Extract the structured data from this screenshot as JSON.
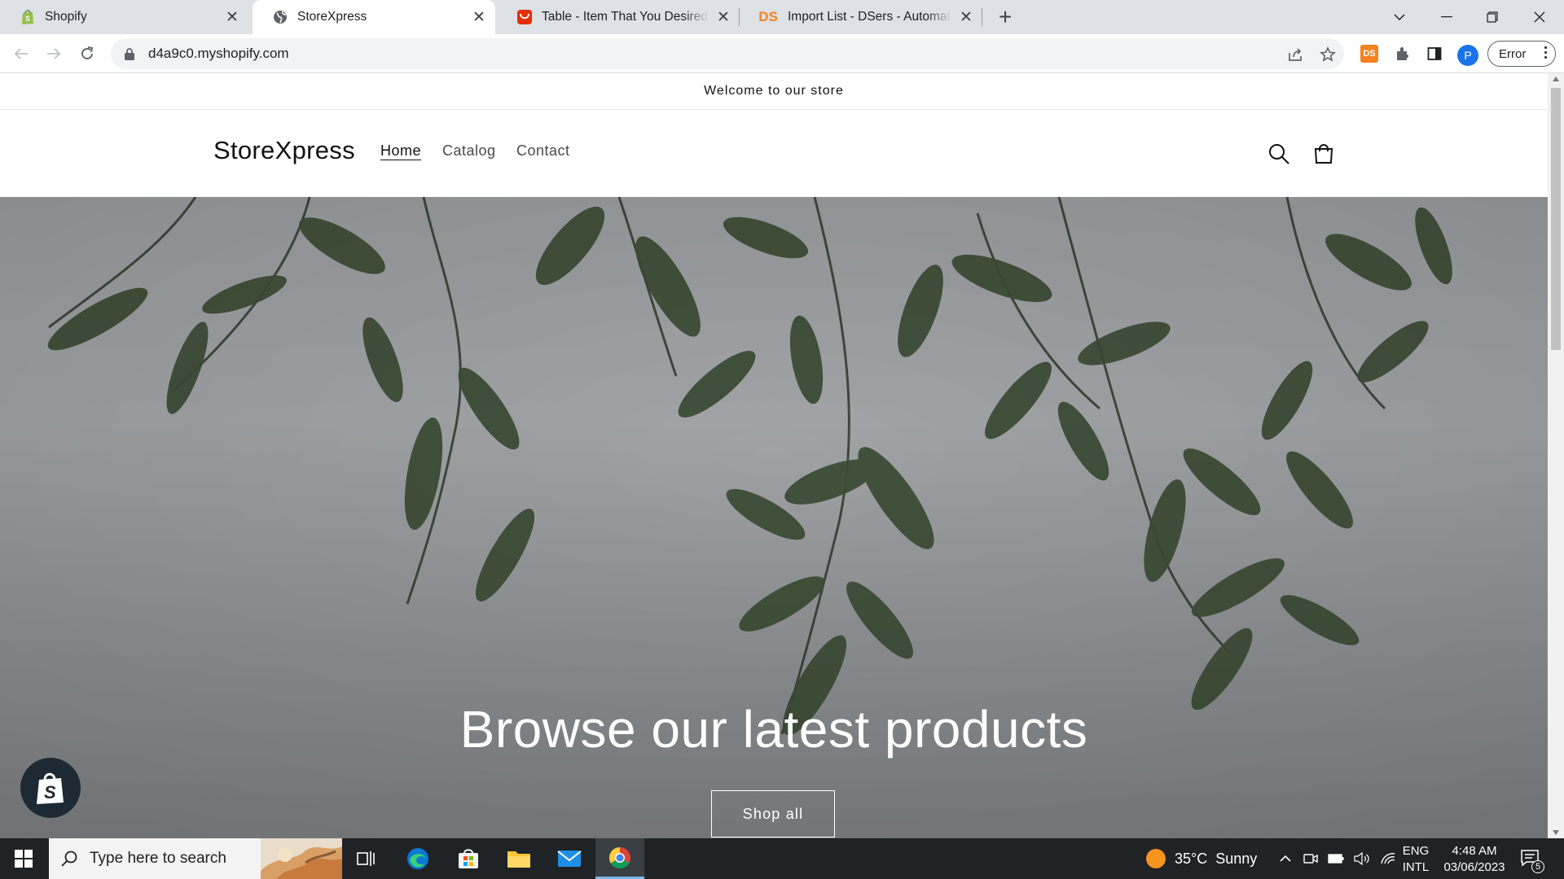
{
  "browser": {
    "tabs": [
      {
        "title": "Shopify",
        "icon": "shopify-icon",
        "active": false
      },
      {
        "title": "StoreXpress",
        "icon": "globe-icon",
        "active": true
      },
      {
        "title": "Table - Item That You Desired - A",
        "icon": "aliexpress-icon",
        "active": false
      },
      {
        "title": "Import List - DSers - Automation",
        "icon": "dsers-icon",
        "active": false
      }
    ],
    "url": "d4a9c0.myshopify.com",
    "profile_initial": "P",
    "error_label": "Error",
    "ds_extension_label": "DS",
    "dsers_favicon_label": "DS"
  },
  "store": {
    "announcement": "Welcome to our store",
    "brand": "StoreXpress",
    "nav": [
      {
        "label": "Home",
        "current": true
      },
      {
        "label": "Catalog",
        "current": false
      },
      {
        "label": "Contact",
        "current": false
      }
    ],
    "hero": {
      "title": "Browse our latest products",
      "button": "Shop all"
    }
  },
  "taskbar": {
    "search_placeholder": "Type here to search",
    "weather": "35°C  Sunny",
    "lang_top": "ENG",
    "lang_bottom": "INTL",
    "time": "4:48 AM",
    "date": "03/06/2023",
    "notification_count": "5"
  },
  "colors": {
    "shopify_green": "#95bf47",
    "aliexpress_red": "#e62e04",
    "dsers_orange": "#f6821f",
    "profile_blue": "#1a73e8",
    "taskbar_bg": "#1f2326"
  }
}
